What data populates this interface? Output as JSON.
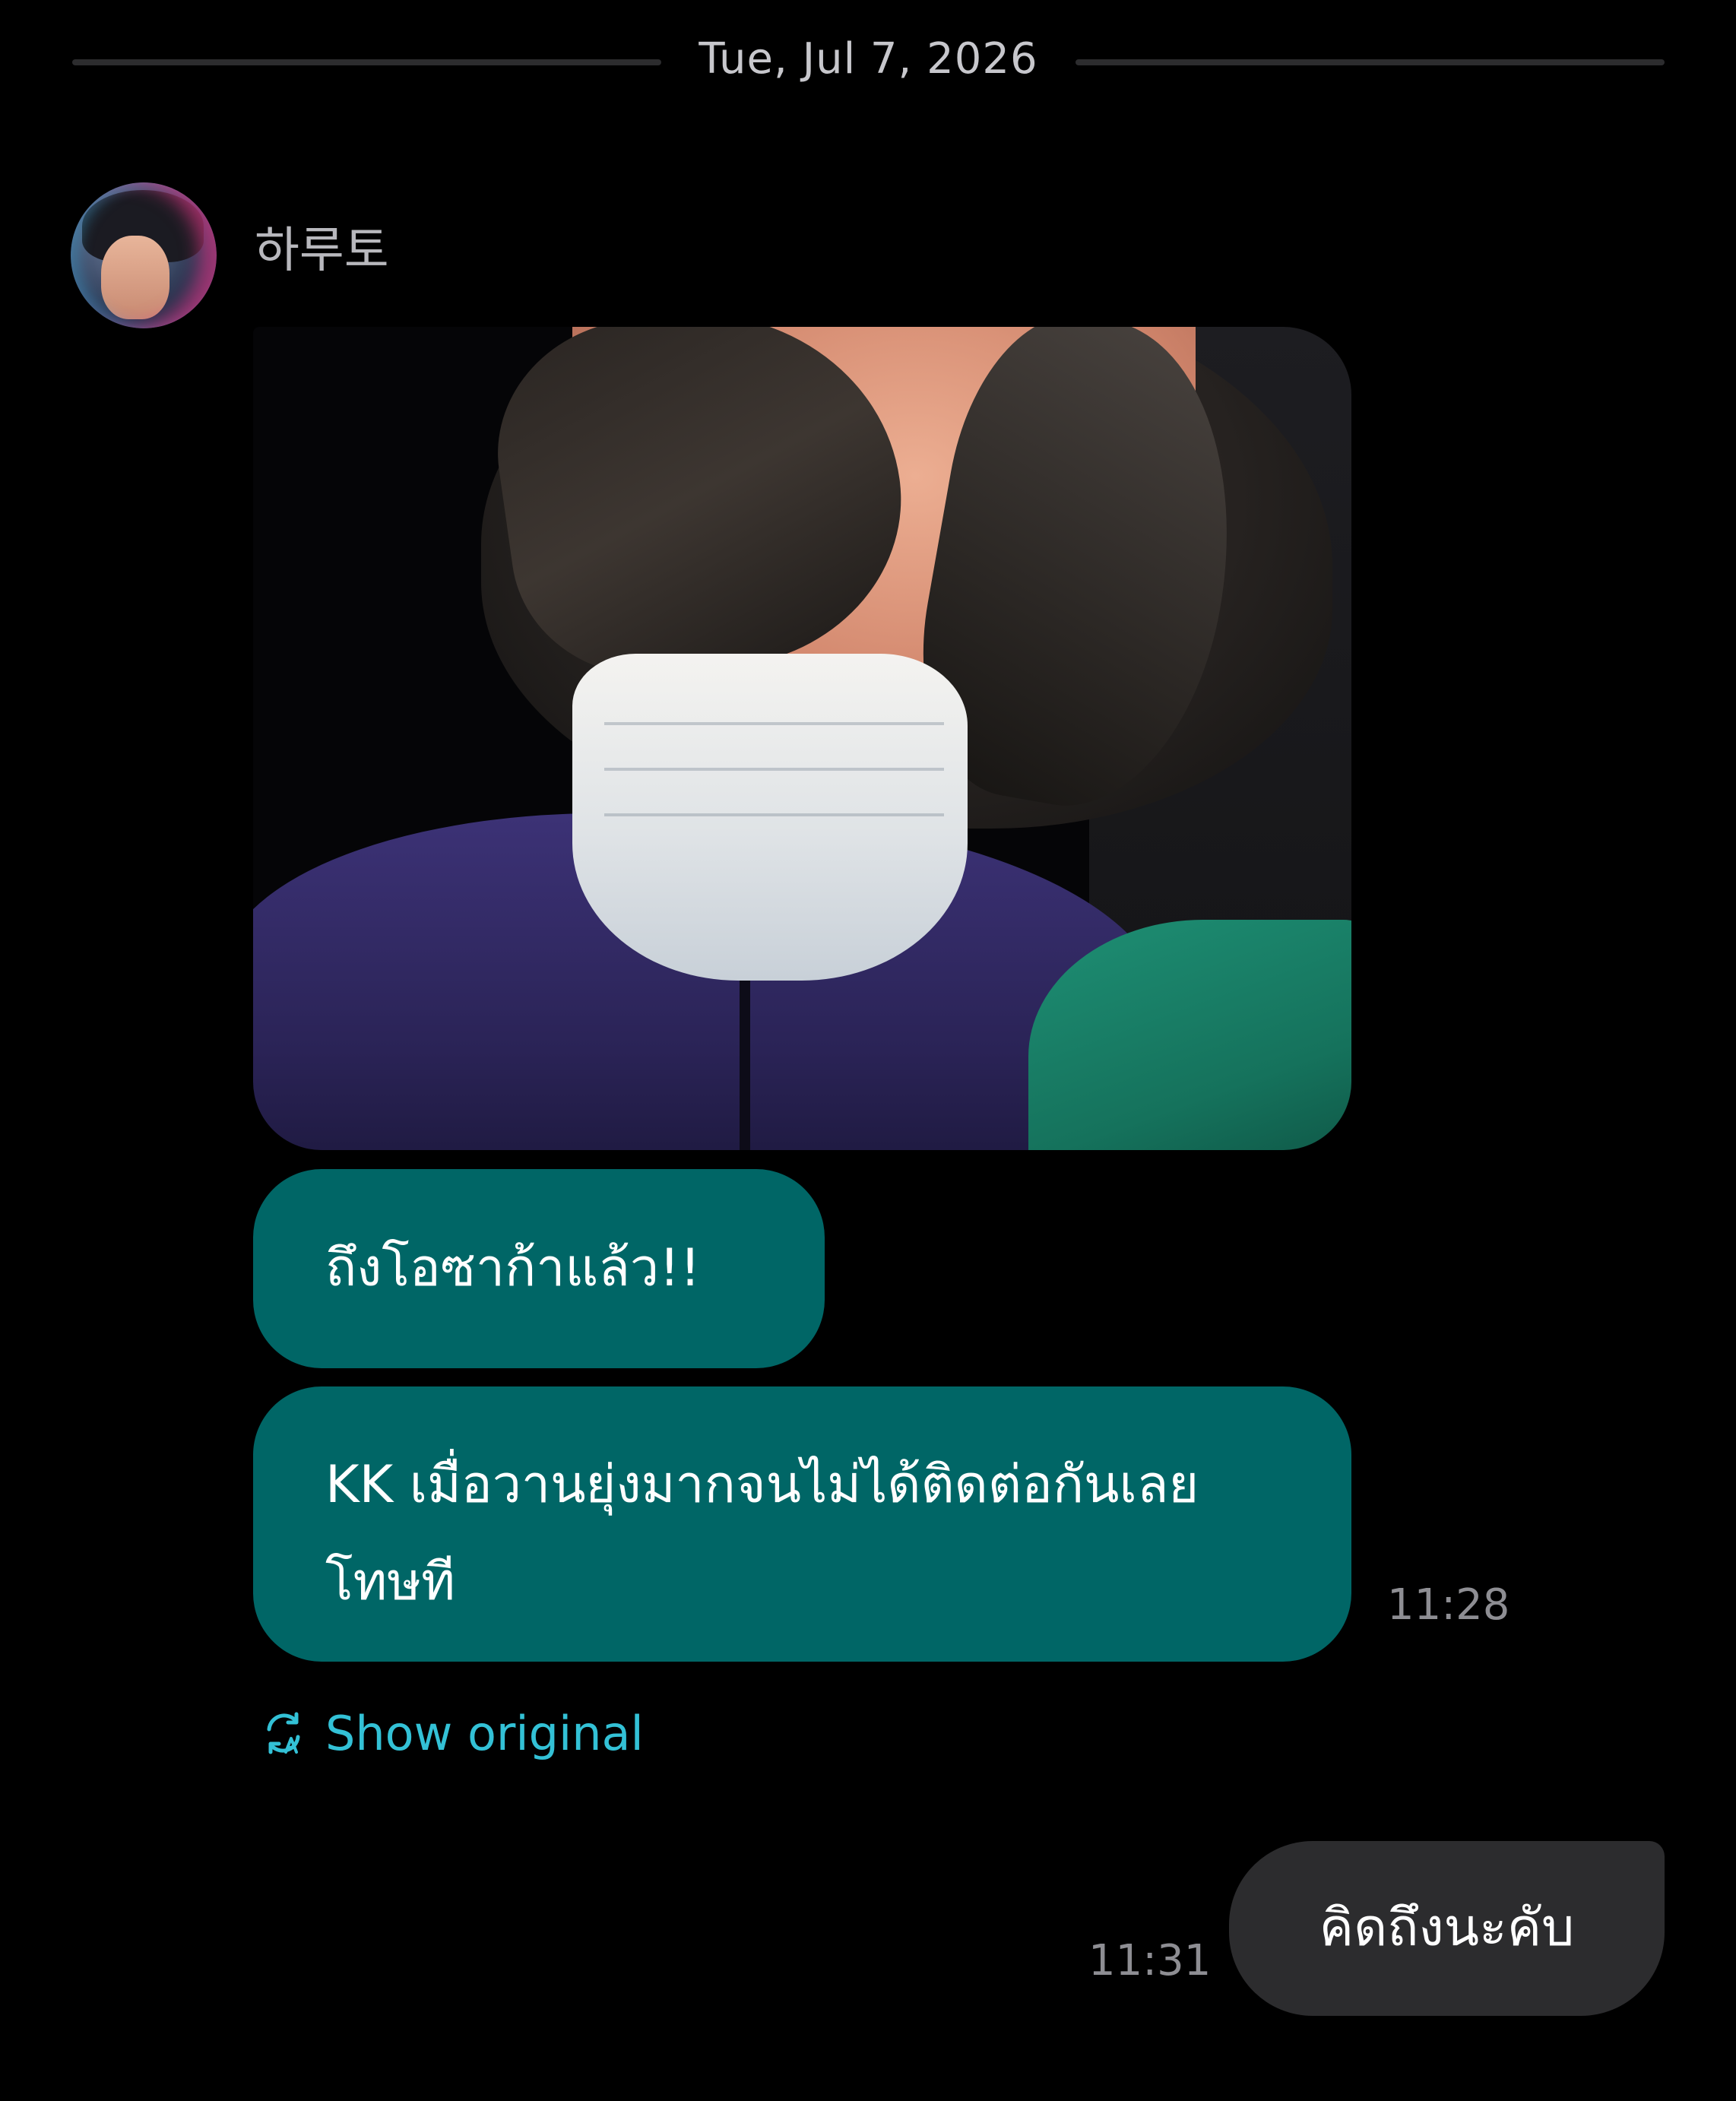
{
  "date_divider": "Tue, Jul 7, 2026",
  "sender": {
    "name": "하루토"
  },
  "messages_in": [
    {
      "text": "ถึงโอซาก้าแล้ว!!"
    },
    {
      "text": "KK เมื่อวานยุ่งมากจนไม่ได้ติดต่อกันเลย โทษที",
      "time": "11:28"
    }
  ],
  "translation": {
    "show_original_label": "Show original"
  },
  "messages_out": [
    {
      "text": "คิดถึงนะคับ",
      "time": "11:31"
    }
  ],
  "colors": {
    "background": "#000000",
    "incoming_bubble": "#006666",
    "outgoing_bubble": "#2c2c2e",
    "link": "#33c1d6",
    "timestamp": "#8e8e93"
  },
  "icons": {
    "translate": "translate-refresh-icon"
  }
}
